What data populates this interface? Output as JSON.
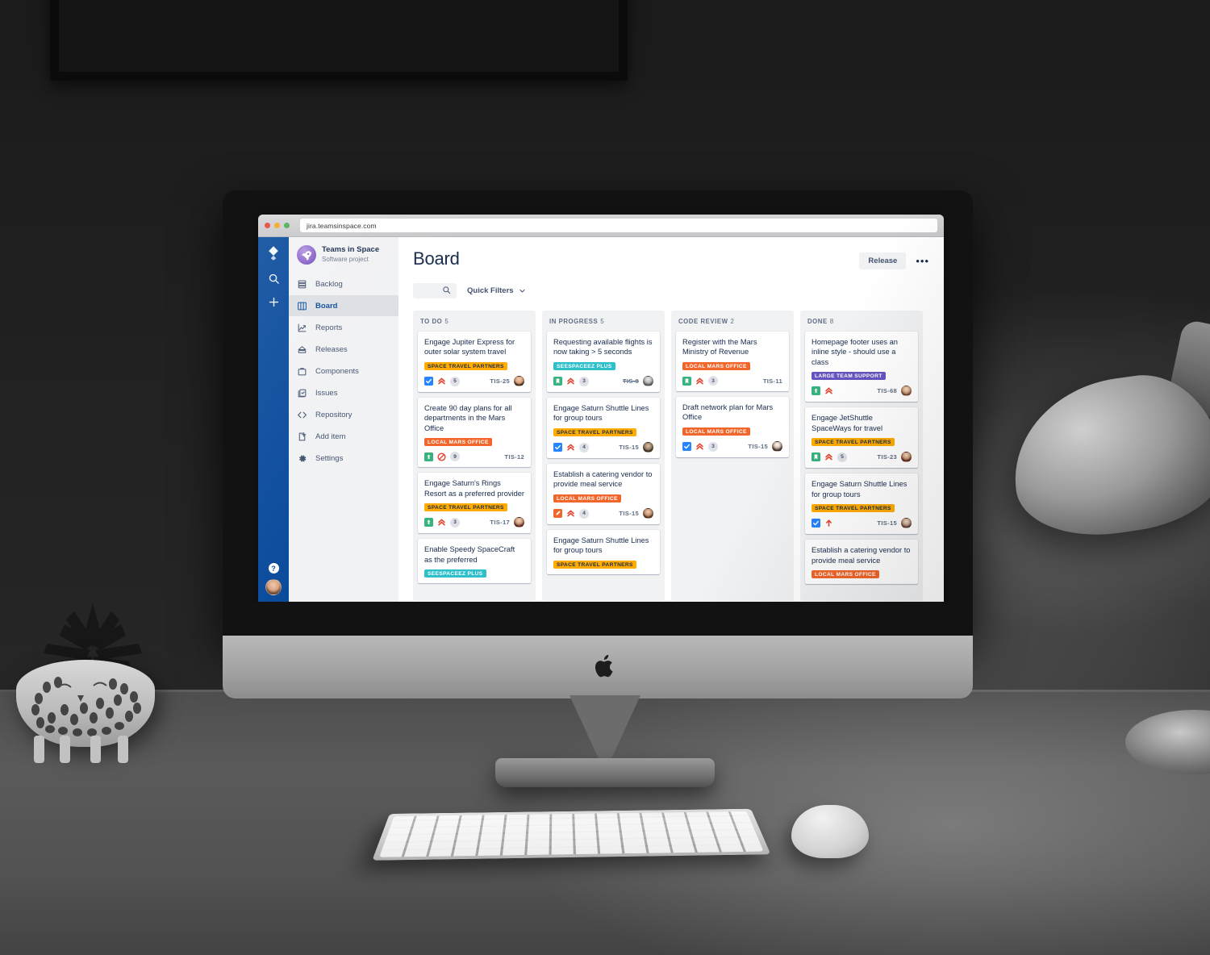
{
  "browser": {
    "url": "jira.teamsinspace.com"
  },
  "rail": {
    "logo_icon": "jira-logo-icon",
    "items": [
      {
        "icon": "search-icon",
        "name": "rail-search"
      },
      {
        "icon": "plus-icon",
        "name": "rail-create"
      }
    ],
    "help_label": "?",
    "avatar_name": "user-avatar"
  },
  "sidebar": {
    "project_name": "Teams in Space",
    "project_type": "Software project",
    "project_avatar_icon": "rocket-icon",
    "items": [
      {
        "label": "Backlog",
        "icon": "backlog-icon",
        "active": false
      },
      {
        "label": "Board",
        "icon": "board-icon",
        "active": true
      },
      {
        "label": "Reports",
        "icon": "reports-icon",
        "active": false
      },
      {
        "label": "Releases",
        "icon": "releases-icon",
        "active": false
      },
      {
        "label": "Components",
        "icon": "components-icon",
        "active": false
      },
      {
        "label": "Issues",
        "icon": "issues-icon",
        "active": false
      },
      {
        "label": "Repository",
        "icon": "code-icon",
        "active": false
      },
      {
        "label": "Add item",
        "icon": "add-item-icon",
        "active": false
      },
      {
        "label": "Settings",
        "icon": "gear-icon",
        "active": false
      }
    ]
  },
  "header": {
    "title": "Board",
    "release_label": "Release",
    "more_label": "•••"
  },
  "toolbar": {
    "search_placeholder": "",
    "search_icon": "search-icon",
    "quick_filters_label": "Quick Filters",
    "chevron_icon": "chevron-down-icon"
  },
  "colors": {
    "rail_blue": "#0a4b9c",
    "sidebar_grey": "#f1f2f4",
    "text_dark": "#172b4d",
    "text_muted": "#5e6c84",
    "loz_orange": "#ffab00",
    "loz_deeporange": "#f1662a",
    "loz_teal": "#2dbfca",
    "loz_purple": "#6554c0",
    "priority_red": "#e34935",
    "story_green": "#36b37e",
    "task_blue": "#2684ff"
  },
  "board": {
    "columns": [
      {
        "name": "TO DO",
        "count": "5",
        "cards": [
          {
            "title": "Engage Jupiter Express for outer solar system travel",
            "label": "SPACE TRAVEL PARTNERS",
            "label_style": "lz-orange",
            "type_icon": "task-checkbox-icon",
            "priority_icon": "priority-highest-icon",
            "count": "5",
            "key": "TIS-25",
            "key_struck": false,
            "avatar": "av1"
          },
          {
            "title": "Create 90 day plans for all departments in the Mars Office",
            "label": "LOCAL MARS OFFICE",
            "label_style": "lz-deeporange",
            "type_icon": "story-icon",
            "priority_icon": "priority-blocker-icon",
            "count": "9",
            "key": "TIS-12",
            "key_struck": false,
            "avatar": ""
          },
          {
            "title": "Engage Saturn's Rings Resort as a preferred provider",
            "label": "SPACE TRAVEL PARTNERS",
            "label_style": "lz-orange",
            "type_icon": "story-icon",
            "priority_icon": "priority-highest-icon",
            "count": "3",
            "key": "TIS-17",
            "key_struck": false,
            "avatar": "av4"
          },
          {
            "title": "Enable Speedy SpaceCraft as the preferred",
            "label": "SEESPACEEZ PLUS",
            "label_style": "lz-teal",
            "type_icon": "",
            "priority_icon": "",
            "count": "",
            "key": "",
            "key_struck": false,
            "avatar": ""
          }
        ]
      },
      {
        "name": "IN PROGRESS",
        "count": "5",
        "cards": [
          {
            "title": "Requesting available flights is now taking > 5 seconds",
            "label": "SEESPACEEZ PLUS",
            "label_style": "lz-teal",
            "type_icon": "bug-bookmark-icon",
            "priority_icon": "priority-highest-icon",
            "count": "3",
            "key": "TIS-8",
            "key_struck": true,
            "avatar": "av2"
          },
          {
            "title": "Engage Saturn Shuttle Lines for group tours",
            "label": "SPACE TRAVEL PARTNERS",
            "label_style": "lz-orange",
            "type_icon": "task-checkbox-icon",
            "priority_icon": "priority-highest-icon",
            "count": "4",
            "key": "TIS-15",
            "key_struck": false,
            "avatar": "av3"
          },
          {
            "title": "Establish a catering vendor to provide meal service",
            "label": "LOCAL MARS OFFICE",
            "label_style": "lz-deeporange",
            "type_icon": "improvement-icon",
            "priority_icon": "priority-highest-icon",
            "count": "4",
            "key": "TIS-15",
            "key_struck": false,
            "avatar": "av5"
          },
          {
            "title": "Engage Saturn Shuttle Lines for group tours",
            "label": "SPACE TRAVEL PARTNERS",
            "label_style": "lz-orange",
            "type_icon": "",
            "priority_icon": "",
            "count": "",
            "key": "",
            "key_struck": false,
            "avatar": ""
          }
        ]
      },
      {
        "name": "CODE REVIEW",
        "count": "2",
        "cards": [
          {
            "title": "Register with the Mars Ministry of Revenue",
            "label": "LOCAL MARS OFFICE",
            "label_style": "lz-deeporange",
            "type_icon": "bug-bookmark-icon",
            "priority_icon": "priority-highest-icon",
            "count": "3",
            "key": "TIS-11",
            "key_struck": false,
            "avatar": ""
          },
          {
            "title": "Draft network plan for Mars Office",
            "label": "LOCAL MARS OFFICE",
            "label_style": "lz-deeporange",
            "type_icon": "task-checkbox-icon",
            "priority_icon": "priority-highest-icon",
            "count": "3",
            "key": "TIS-15",
            "key_struck": false,
            "avatar": "av6"
          }
        ]
      },
      {
        "name": "DONE",
        "count": "8",
        "cards": [
          {
            "title": "Homepage footer uses an inline style - should use a class",
            "label": "LARGE TEAM SUPPORT",
            "label_style": "lz-purple",
            "type_icon": "story-icon",
            "priority_icon": "priority-highest-icon",
            "count": "",
            "key": "TIS-68",
            "key_struck": false,
            "avatar": "av7"
          },
          {
            "title": "Engage JetShuttle SpaceWays for travel",
            "label": "SPACE TRAVEL PARTNERS",
            "label_style": "lz-orange",
            "type_icon": "bug-bookmark-icon",
            "priority_icon": "priority-highest-icon",
            "count": "5",
            "key": "TIS-23",
            "key_struck": false,
            "avatar": "av4"
          },
          {
            "title": "Engage Saturn Shuttle Lines for group tours",
            "label": "SPACE TRAVEL PARTNERS",
            "label_style": "lz-orange",
            "type_icon": "task-checkbox-icon",
            "priority_icon": "priority-high-icon",
            "count": "",
            "key": "TIS-15",
            "key_struck": false,
            "avatar": "av8"
          },
          {
            "title": "Establish a catering vendor to provide meal service",
            "label": "LOCAL MARS OFFICE",
            "label_style": "lz-deeporange",
            "type_icon": "",
            "priority_icon": "",
            "count": "",
            "key": "",
            "key_struck": false,
            "avatar": ""
          }
        ]
      }
    ]
  }
}
